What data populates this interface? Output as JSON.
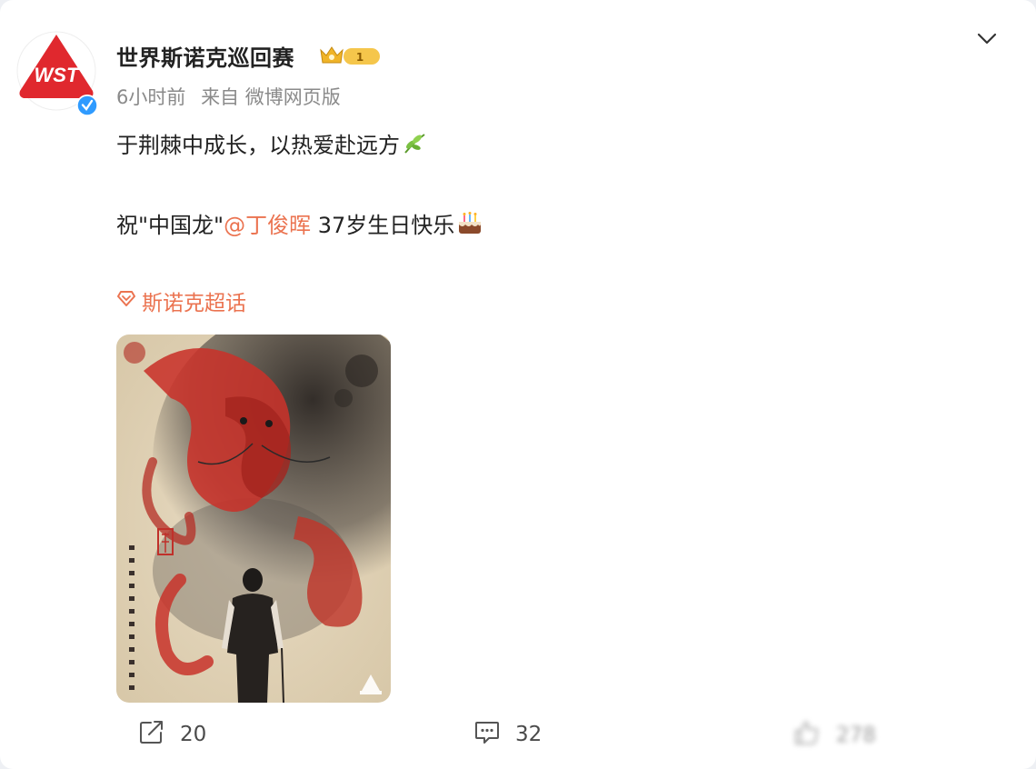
{
  "post": {
    "username": "世界斯诺克巡回赛",
    "vip_level": "1",
    "time": "6小时前",
    "source": "来自 微博网页版",
    "line1": "于荆棘中成长，以热爱赴远方",
    "line2_prefix": "祝\"中国龙\"",
    "mention": "@丁俊晖",
    "line2_suffix": " 37岁生日快乐",
    "topic": "斯诺克超话",
    "logo_text": "WST"
  },
  "actions": {
    "share_count": "20",
    "comment_count": "32",
    "like_count": "278"
  },
  "colors": {
    "accent": "#eb7350",
    "logo_red": "#e0282e",
    "verified_blue": "#2f9bff",
    "vip_gold": "#f5c64b"
  },
  "icons": {
    "verified": "verified-badge-icon",
    "vip": "crown-icon",
    "menu": "chevron-down-icon",
    "leaf": "leaf-emoji-icon",
    "cake": "cake-emoji-icon",
    "topic": "diamond-icon",
    "share": "share-icon",
    "comment": "comment-icon",
    "like": "thumbs-up-icon"
  }
}
